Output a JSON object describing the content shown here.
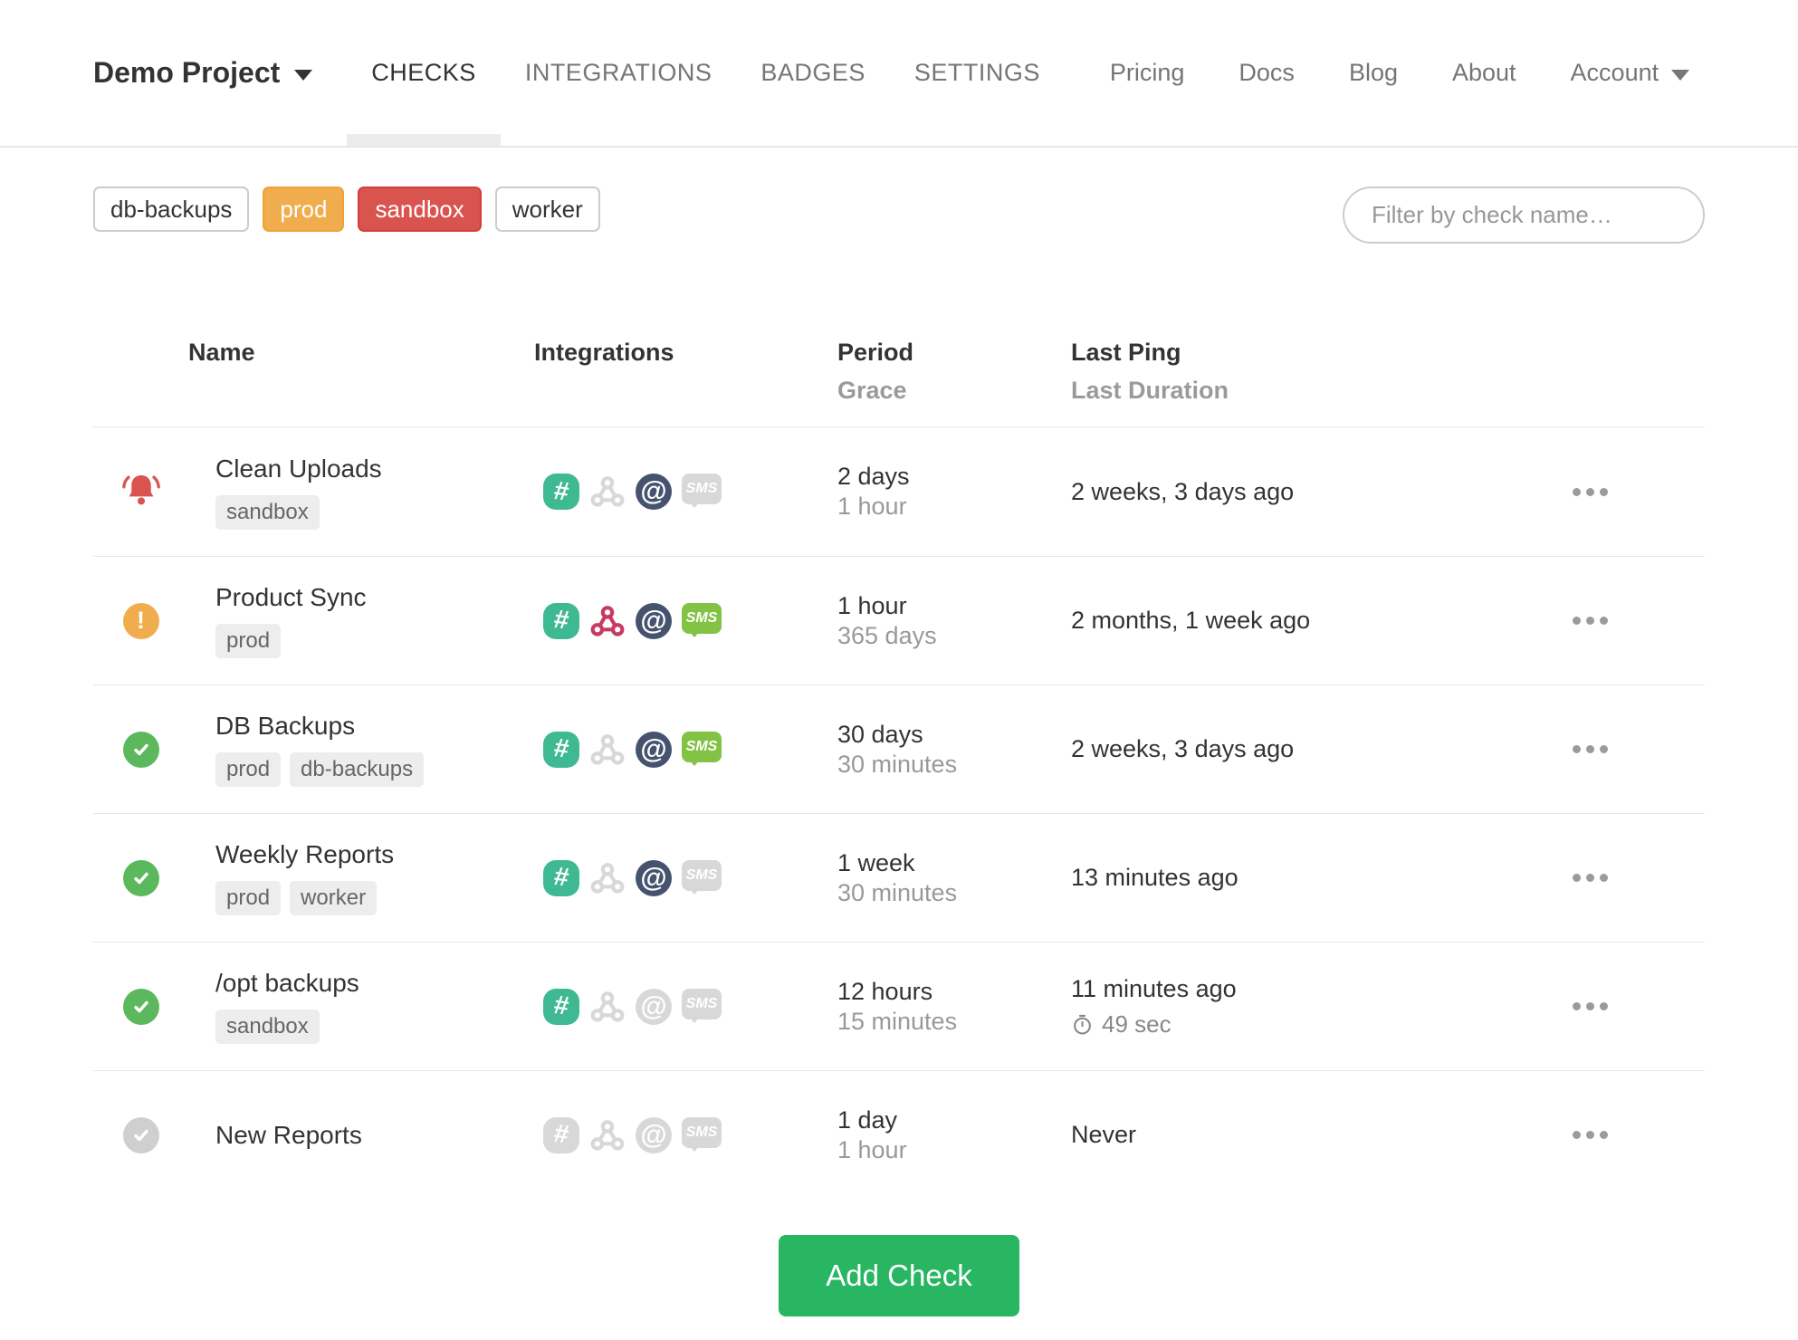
{
  "nav": {
    "project_label": "Demo Project",
    "tabs": [
      {
        "label": "CHECKS",
        "active": true
      },
      {
        "label": "INTEGRATIONS",
        "active": false
      },
      {
        "label": "BADGES",
        "active": false
      },
      {
        "label": "SETTINGS",
        "active": false
      }
    ],
    "links": [
      {
        "label": "Pricing"
      },
      {
        "label": "Docs"
      },
      {
        "label": "Blog"
      },
      {
        "label": "About"
      }
    ],
    "account_label": "Account"
  },
  "filters": {
    "tags": [
      {
        "label": "db-backups",
        "style": "default"
      },
      {
        "label": "prod",
        "style": "warning"
      },
      {
        "label": "sandbox",
        "style": "danger"
      },
      {
        "label": "worker",
        "style": "default"
      }
    ],
    "search_placeholder": "Filter by check name…"
  },
  "table": {
    "headers": {
      "name": "Name",
      "integrations": "Integrations",
      "period": "Period",
      "grace": "Grace",
      "last_ping": "Last Ping",
      "last_duration": "Last Duration"
    },
    "rows": [
      {
        "status": "alert",
        "name": "Clean Uploads",
        "tags": [
          "sandbox"
        ],
        "integrations": {
          "slack": true,
          "webhook": false,
          "email": true,
          "sms": false
        },
        "period": "2 days",
        "grace": "1 hour",
        "last_ping": "2 weeks, 3 days ago",
        "last_duration": ""
      },
      {
        "status": "warning",
        "name": "Product Sync",
        "tags": [
          "prod"
        ],
        "integrations": {
          "slack": true,
          "webhook": true,
          "email": true,
          "sms": true
        },
        "period": "1 hour",
        "grace": "365 days",
        "last_ping": "2 months, 1 week ago",
        "last_duration": ""
      },
      {
        "status": "ok",
        "name": "DB Backups",
        "tags": [
          "prod",
          "db-backups"
        ],
        "integrations": {
          "slack": true,
          "webhook": false,
          "email": true,
          "sms": true
        },
        "period": "30 days",
        "grace": "30 minutes",
        "last_ping": "2 weeks, 3 days ago",
        "last_duration": ""
      },
      {
        "status": "ok",
        "name": "Weekly Reports",
        "tags": [
          "prod",
          "worker"
        ],
        "integrations": {
          "slack": true,
          "webhook": false,
          "email": true,
          "sms": false
        },
        "period": "1 week",
        "grace": "30 minutes",
        "last_ping": "13 minutes ago",
        "last_duration": ""
      },
      {
        "status": "ok",
        "name": "/opt backups",
        "tags": [
          "sandbox"
        ],
        "integrations": {
          "slack": true,
          "webhook": false,
          "email": false,
          "sms": false
        },
        "period": "12 hours",
        "grace": "15 minutes",
        "last_ping": "11 minutes ago",
        "last_duration": "49 sec"
      },
      {
        "status": "new",
        "name": "New Reports",
        "tags": [],
        "integrations": {
          "slack": false,
          "webhook": false,
          "email": false,
          "sms": false
        },
        "period": "1 day",
        "grace": "1 hour",
        "last_ping": "Never",
        "last_duration": ""
      }
    ]
  },
  "actions": {
    "add_check_label": "Add Check"
  },
  "colors": {
    "status_ok": "#5cb85c",
    "status_warning": "#f0ad4e",
    "status_alert": "#d9534f",
    "status_new": "#cfcfcf",
    "tag_warning": "#f0ad4e",
    "tag_danger": "#d9534f",
    "slack": "#3eb991",
    "webhook": "#c73a63",
    "email": "#45536e",
    "sms": "#82c245",
    "add_button": "#28b662"
  }
}
